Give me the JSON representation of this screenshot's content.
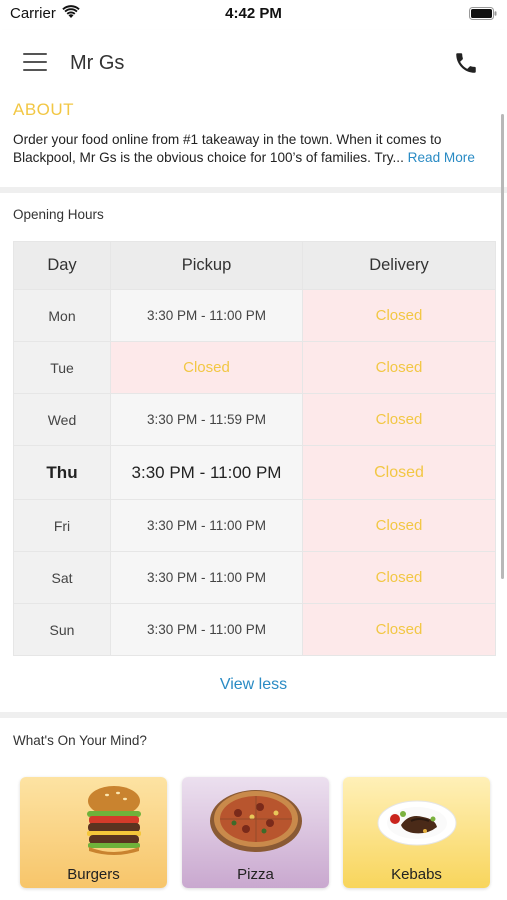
{
  "status_bar": {
    "carrier": "Carrier",
    "time": "4:42 PM"
  },
  "header": {
    "title": "Mr Gs"
  },
  "about": {
    "title": "ABOUT",
    "text": "Order your food online from #1 takeaway in the town. When it comes to Blackpool, Mr Gs is the obvious choice for 100’s of families. Try...",
    "read_more": "Read More"
  },
  "opening_hours": {
    "title": "Opening Hours",
    "columns": [
      "Day",
      "Pickup",
      "Delivery"
    ],
    "rows": [
      {
        "day": "Mon",
        "pickup": "3:30 PM - 11:00 PM",
        "delivery": "Closed",
        "pickup_closed": false,
        "delivery_closed": true
      },
      {
        "day": "Tue",
        "pickup": "Closed",
        "delivery": "Closed",
        "pickup_closed": true,
        "delivery_closed": true
      },
      {
        "day": "Wed",
        "pickup": "3:30 PM - 11:59 PM",
        "delivery": "Closed",
        "pickup_closed": false,
        "delivery_closed": true
      },
      {
        "day": "Thu",
        "pickup": "3:30 PM - 11:00 PM",
        "delivery": "Closed",
        "pickup_closed": false,
        "delivery_closed": true,
        "today": true
      },
      {
        "day": "Fri",
        "pickup": "3:30 PM - 11:00 PM",
        "delivery": "Closed",
        "pickup_closed": false,
        "delivery_closed": true
      },
      {
        "day": "Sat",
        "pickup": "3:30 PM - 11:00 PM",
        "delivery": "Closed",
        "pickup_closed": false,
        "delivery_closed": true
      },
      {
        "day": "Sun",
        "pickup": "3:30 PM - 11:00 PM",
        "delivery": "Closed",
        "pickup_closed": false,
        "delivery_closed": true
      }
    ],
    "view_less": "View less"
  },
  "categories": {
    "title": "What's On Your Mind?",
    "items": [
      {
        "label": "Burgers",
        "icon": "burger-icon"
      },
      {
        "label": "Pizza",
        "icon": "pizza-icon"
      },
      {
        "label": "Kebabs",
        "icon": "kebab-plate-icon"
      }
    ]
  },
  "colors": {
    "accent_yellow": "#f2c744",
    "link_blue": "#2a8bc4",
    "closed_bg": "#fde9ea"
  }
}
